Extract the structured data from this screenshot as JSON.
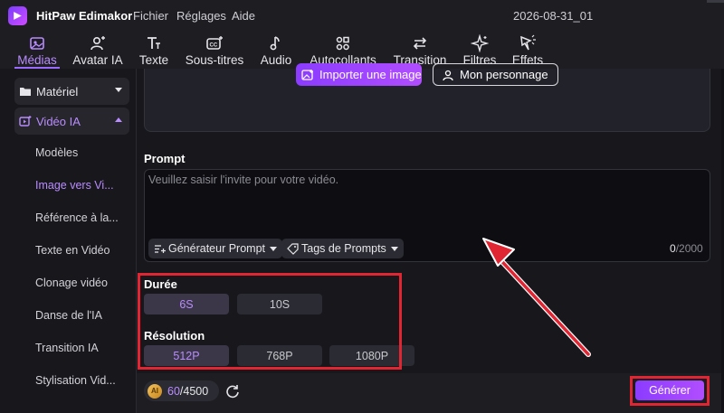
{
  "app": {
    "name": "HitPaw Edimakor",
    "menu": [
      "Fichier",
      "Réglages",
      "Aide"
    ],
    "doc_title": "2026-08-31_01"
  },
  "toolbar": [
    {
      "label": "Médias",
      "icon": "media-icon"
    },
    {
      "label": "Avatar IA",
      "icon": "avatar-icon"
    },
    {
      "label": "Texte",
      "icon": "text-icon"
    },
    {
      "label": "Sous-titres",
      "icon": "subtitles-icon"
    },
    {
      "label": "Audio",
      "icon": "audio-icon"
    },
    {
      "label": "Autocollants",
      "icon": "stickers-icon"
    },
    {
      "label": "Transition",
      "icon": "transition-icon"
    },
    {
      "label": "Filtres",
      "icon": "filters-icon"
    },
    {
      "label": "Effets",
      "icon": "effects-icon"
    }
  ],
  "sidebar": {
    "categories": [
      {
        "label": "Matériel",
        "icon": "folder-icon"
      },
      {
        "label": "Vidéo IA",
        "icon": "ai-video-icon"
      }
    ],
    "items": [
      "Modèles",
      "Image vers Vi...",
      "Référence à la...",
      "Texte en Vidéo",
      "Clonage vidéo",
      "Danse de l'IA",
      "Transition IA",
      "Stylisation Vid..."
    ]
  },
  "upload": {
    "import_label": "Importer une image",
    "character_label": "Mon personnage"
  },
  "prompt": {
    "title": "Prompt",
    "placeholder": "Veuillez saisir l'invite pour votre vidéo.",
    "generator_label": "Générateur Prompt",
    "tags_label": "Tags de Prompts",
    "count": "0",
    "max": "/2000"
  },
  "duration": {
    "title": "Durée",
    "options": [
      "6S",
      "10S"
    ],
    "selected": "6S"
  },
  "resolution": {
    "title": "Résolution",
    "options": [
      "512P",
      "768P",
      "1080P"
    ],
    "selected": "512P"
  },
  "credits": {
    "coin": "AI",
    "used": "60",
    "total": "/4500"
  },
  "generate_label": "Générer",
  "colors": {
    "accent": "#b98cff",
    "button_gradient_start": "#8b3cff",
    "button_gradient_end": "#b14dff",
    "highlight_red": "#e02533"
  }
}
